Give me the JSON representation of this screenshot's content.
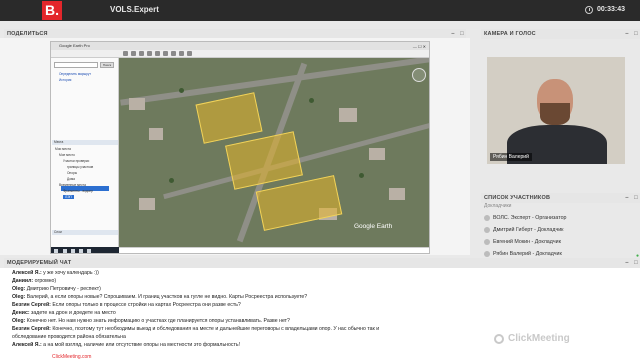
{
  "topbar": {
    "logo": "B.",
    "title": "VOLS.Expert",
    "timer": "00:33:43"
  },
  "share": {
    "header": "ПОДЕЛИТЬСЯ",
    "window_title": "Google Earth Pro",
    "search_button": "Поиск",
    "side_links": [
      "Определить маршрут",
      "История"
    ],
    "places_header": "Места",
    "layers_header": "Слои",
    "tree_items": [
      "Мои места",
      "Мое место",
      "Участки проверки",
      "границы участков",
      "Опоры",
      "Дома",
      "Временные места",
      "Фрагменты - водопр",
      "ЛЭП"
    ],
    "map_logo": "Google Earth"
  },
  "camera": {
    "header": "КАМЕРА И ГОЛОС",
    "label": "Рябин Валерий"
  },
  "participants": {
    "header": "СПИСОК УЧАСТНИКОВ",
    "group": "Докладчики",
    "items": [
      {
        "name": "ВОЛС. Эксперт - Организатор"
      },
      {
        "name": "Дмитрий Гиберт - Докладчик"
      },
      {
        "name": "Евгений Мокин - Докладчик"
      },
      {
        "name": "Рябин Валерий - Докладчик"
      }
    ]
  },
  "chat": {
    "header": "МОДЕРИРУЕМЫЙ ЧАТ",
    "messages": [
      {
        "author": "Алексей Я.:",
        "text": " у же хочу календарь :))"
      },
      {
        "author": "Даниил:",
        "text": " огромно)"
      },
      {
        "author": "Oleg:",
        "text": " Дмитрию Петровичу - респект)"
      },
      {
        "author": "Oleg:",
        "text": " Валерий, а если опоры новые?   Спрошиваем. И границ участков на гугле не видно. Карты Росреестра используете?"
      },
      {
        "author": "Безгин Сергей:",
        "text": " Если опоры только в процессе стройки на картах Росреестра они разве есть?"
      },
      {
        "author": "Денис:",
        "text": " задете на дрон и доедете на место"
      },
      {
        "author": "Oleg:",
        "text": " Конечно нет. Но нам нужно знать информацию о участках где планируется опоры устанавливать. Разве нет?"
      },
      {
        "author": "Безгин Сергей:",
        "text": " Конечно, поэтому тут необходимы выезд и обследования на месте и дальнейшие переговоры с владельцами опор. У нас обычно так и"
      },
      {
        "author": "",
        "text": "обследование проводится района обязательна"
      },
      {
        "author": "Алексей Я.:",
        "text": " а на мой взгляд, наличие или отсутствие опоры на местности это формальность!"
      }
    ],
    "footer": "ClickMeeting.com"
  },
  "branding": "ClickMeeting",
  "colors": {
    "brand_red": "#e3262b",
    "topbar": "#2a2a2a",
    "mic_green": "#3fae49"
  }
}
